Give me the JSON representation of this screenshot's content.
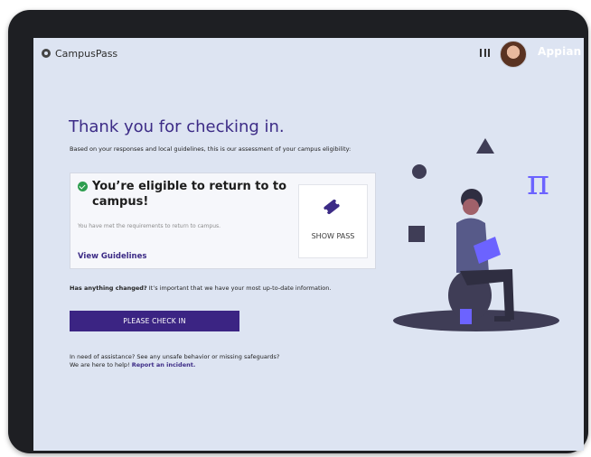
{
  "app": {
    "name": "CampusPass",
    "vendor_logo": "Appian"
  },
  "header": {
    "menu_icon": "grid-icon",
    "avatar_icon": "user-avatar"
  },
  "main": {
    "title": "Thank you for checking in.",
    "assessment_text": "Based on your responses and local guidelines, this is our assessment of your campus eligibility:",
    "status": {
      "icon": "check-circle-icon",
      "color": "#2e9e4f",
      "heading": "You’re eligible to return to to campus!",
      "description": "You have met the requirements to return to campus.",
      "guidelines_link": "View Guidelines"
    },
    "pass": {
      "icon": "ticket-icon",
      "label": "SHOW PASS"
    },
    "changed": {
      "question": "Has anything changed?",
      "text": " It’s important that we have your most up-to-date information."
    },
    "checkin_button": "PLEASE CHECK IN",
    "help": {
      "line1": "In need of assistance? See any unsafe behavior or missing safeguards?",
      "line2": "We are here to help! ",
      "link": "Report an incident."
    }
  },
  "illustration": {
    "symbol": "π"
  },
  "colors": {
    "accent": "#3c2b86",
    "button": "#3b2483",
    "background": "#dde4f2",
    "illustration_purple": "#6c63ff",
    "illustration_dark": "#3f3d56"
  }
}
